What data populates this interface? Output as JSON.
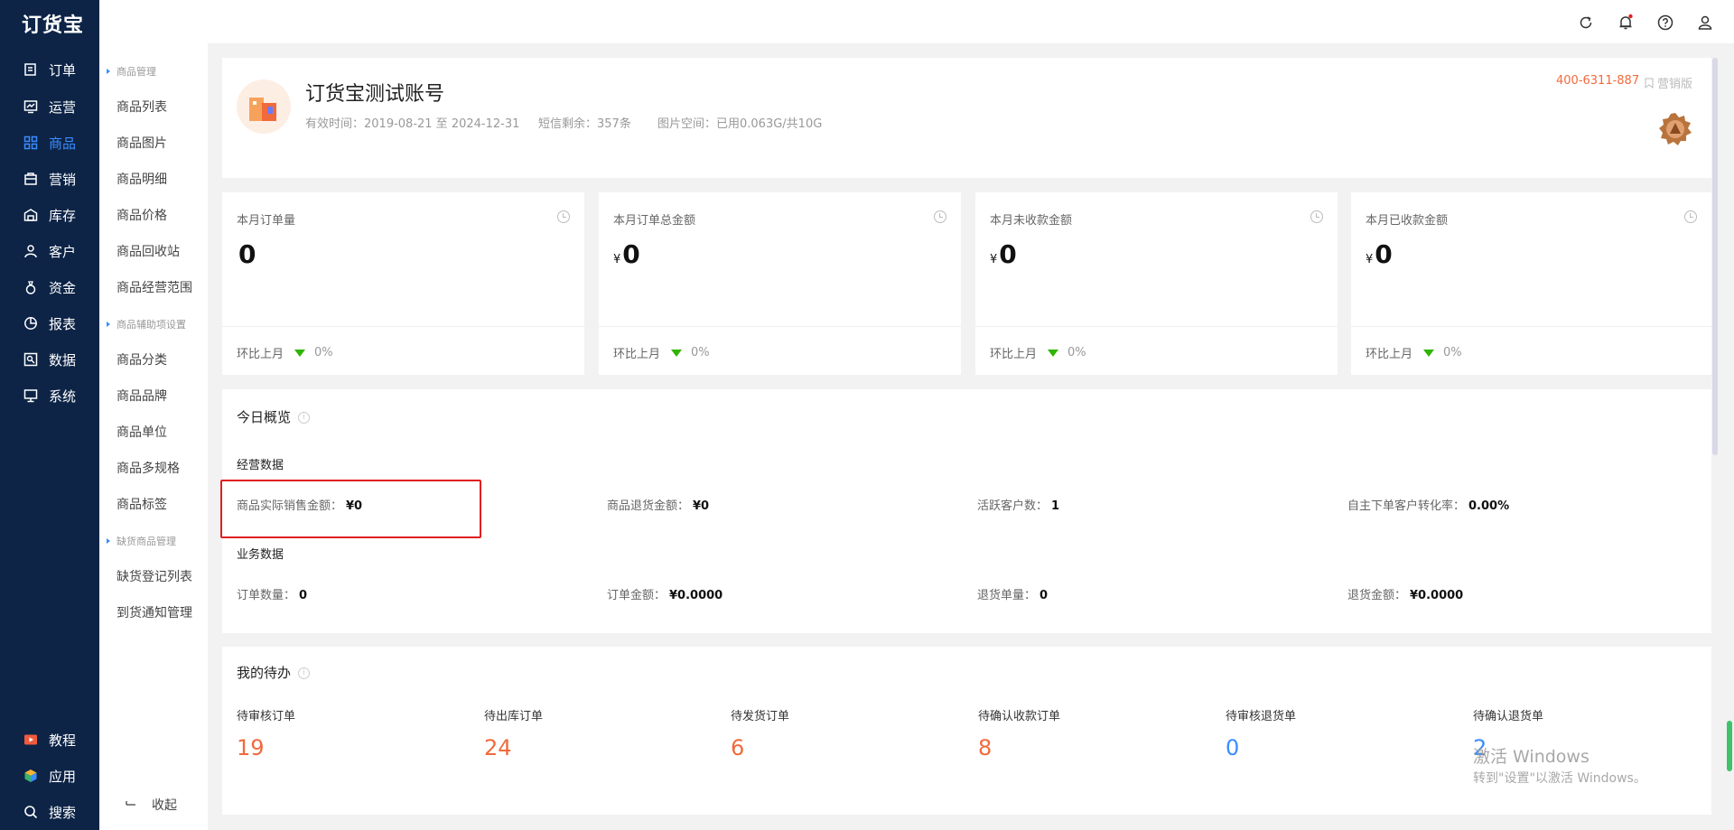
{
  "app": {
    "logo": "订货宝"
  },
  "nav": {
    "items": [
      {
        "label": "订单",
        "icon": "order-icon",
        "active": false
      },
      {
        "label": "运营",
        "icon": "operation-icon",
        "active": false
      },
      {
        "label": "商品",
        "icon": "product-grid-icon",
        "active": true
      },
      {
        "label": "营销",
        "icon": "marketing-icon",
        "active": false
      },
      {
        "label": "库存",
        "icon": "warehouse-icon",
        "active": false
      },
      {
        "label": "客户",
        "icon": "customer-icon",
        "active": false
      },
      {
        "label": "资金",
        "icon": "money-bag-icon",
        "active": false
      },
      {
        "label": "报表",
        "icon": "pie-chart-icon",
        "active": false
      },
      {
        "label": "数据",
        "icon": "data-icon",
        "active": false
      },
      {
        "label": "系统",
        "icon": "monitor-icon",
        "active": false
      }
    ],
    "bottom": [
      {
        "label": "教程",
        "icon": "video-icon"
      },
      {
        "label": "应用",
        "icon": "cube-icon"
      },
      {
        "label": "搜索",
        "icon": "search-icon"
      }
    ]
  },
  "submenu": {
    "group1": "商品管理",
    "group1_items": [
      "商品列表",
      "商品图片",
      "商品明细",
      "商品价格",
      "商品回收站",
      "商品经营范围"
    ],
    "group2": "商品辅助项设置",
    "group2_items": [
      "商品分类",
      "商品品牌",
      "商品单位",
      "商品多规格",
      "商品标签"
    ],
    "group3": "缺货商品管理",
    "group3_items": [
      "缺货登记列表",
      "到货通知管理"
    ],
    "collapse": "收起"
  },
  "account": {
    "name": "订货宝测试账号",
    "validity": "有效时间：2019-08-21 至 2024-12-31",
    "sms": "短信剩余：357条",
    "space": "图片空间：已用0.063G/共10G",
    "phone": "400-6311-887",
    "edition": "营销版"
  },
  "stats": [
    {
      "title": "本月订单量",
      "currency": "",
      "value": "0",
      "compare": "环比上月",
      "pct": "0%"
    },
    {
      "title": "本月订单总金额",
      "currency": "¥",
      "value": "0",
      "compare": "环比上月",
      "pct": "0%"
    },
    {
      "title": "本月未收款金额",
      "currency": "¥",
      "value": "0",
      "compare": "环比上月",
      "pct": "0%"
    },
    {
      "title": "本月已收款金额",
      "currency": "¥",
      "value": "0",
      "compare": "环比上月",
      "pct": "0%"
    }
  ],
  "overview": {
    "title": "今日概览",
    "business_title": "经营数据",
    "business": [
      {
        "label": "商品实际销售金额：",
        "value": "¥0"
      },
      {
        "label": "商品退货金额：",
        "value": "¥0"
      },
      {
        "label": "活跃客户数：",
        "value": "1"
      },
      {
        "label": "自主下单客户转化率：",
        "value": "0.00%"
      }
    ],
    "service_title": "业务数据",
    "service": [
      {
        "label": "订单数量：",
        "value": "0"
      },
      {
        "label": "订单金额：",
        "value": "¥0.0000"
      },
      {
        "label": "退货单量：",
        "value": "0"
      },
      {
        "label": "退货金额：",
        "value": "¥0.0000"
      }
    ]
  },
  "todo": {
    "title": "我的待办",
    "items": [
      {
        "label": "待审核订单",
        "value": "19",
        "color": "#f06a3c"
      },
      {
        "label": "待出库订单",
        "value": "24",
        "color": "#f06a3c"
      },
      {
        "label": "待发货订单",
        "value": "6",
        "color": "#f06a3c"
      },
      {
        "label": "待确认收款订单",
        "value": "8",
        "color": "#f06a3c"
      },
      {
        "label": "待审核退货单",
        "value": "0",
        "color": "#3a8dff"
      },
      {
        "label": "待确认退货单",
        "value": "2",
        "color": "#3a8dff"
      }
    ]
  },
  "watermark": {
    "line1": "激活 Windows",
    "line2": "转到\"设置\"以激活 Windows。"
  },
  "colors": {
    "nav_bg": "#0d2447",
    "accent": "#3a8dff",
    "orange": "#f06a3c",
    "highlight": "#e02020"
  }
}
